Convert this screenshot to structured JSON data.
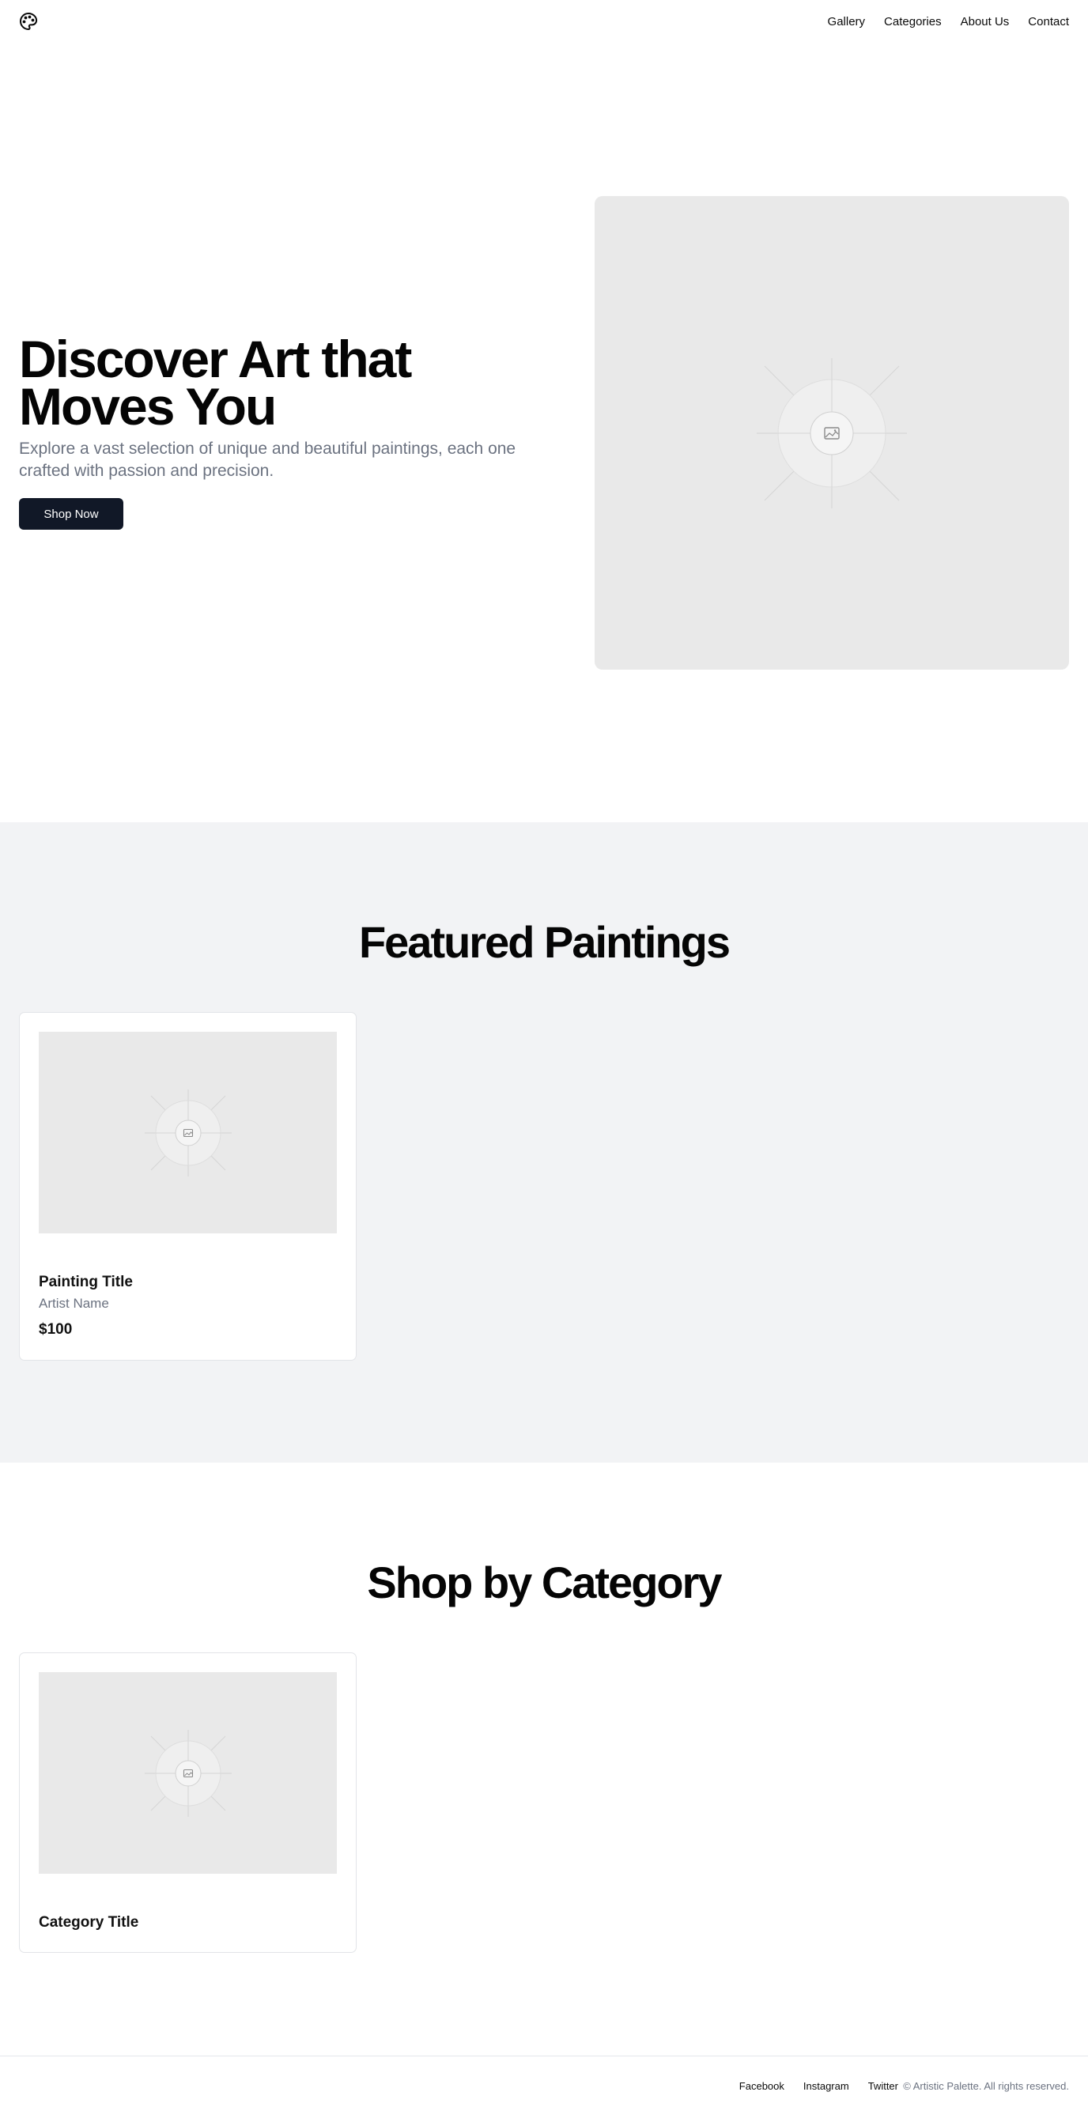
{
  "header": {
    "logo_icon": "palette-icon",
    "nav": [
      "Gallery",
      "Categories",
      "About Us",
      "Contact"
    ]
  },
  "hero": {
    "title": "Discover Art that Moves You",
    "subtitle": "Explore a vast selection of unique and beautiful paintings, each one crafted with passion and precision.",
    "cta_label": "Shop Now",
    "image_icon": "image-placeholder-icon"
  },
  "featured": {
    "title": "Featured Paintings",
    "cards": [
      {
        "title": "Painting Title",
        "artist": "Artist Name",
        "price": "$100"
      }
    ]
  },
  "categories": {
    "title": "Shop by Category",
    "cards": [
      {
        "title": "Category Title"
      }
    ]
  },
  "footer": {
    "links": [
      "Facebook",
      "Instagram",
      "Twitter"
    ],
    "copyright": "© Artistic Palette. All rights reserved."
  },
  "colors": {
    "primary_button": "#111827",
    "featured_background": "#f2f3f5",
    "muted_text": "#6b7280",
    "placeholder": "#e9e9e9"
  }
}
